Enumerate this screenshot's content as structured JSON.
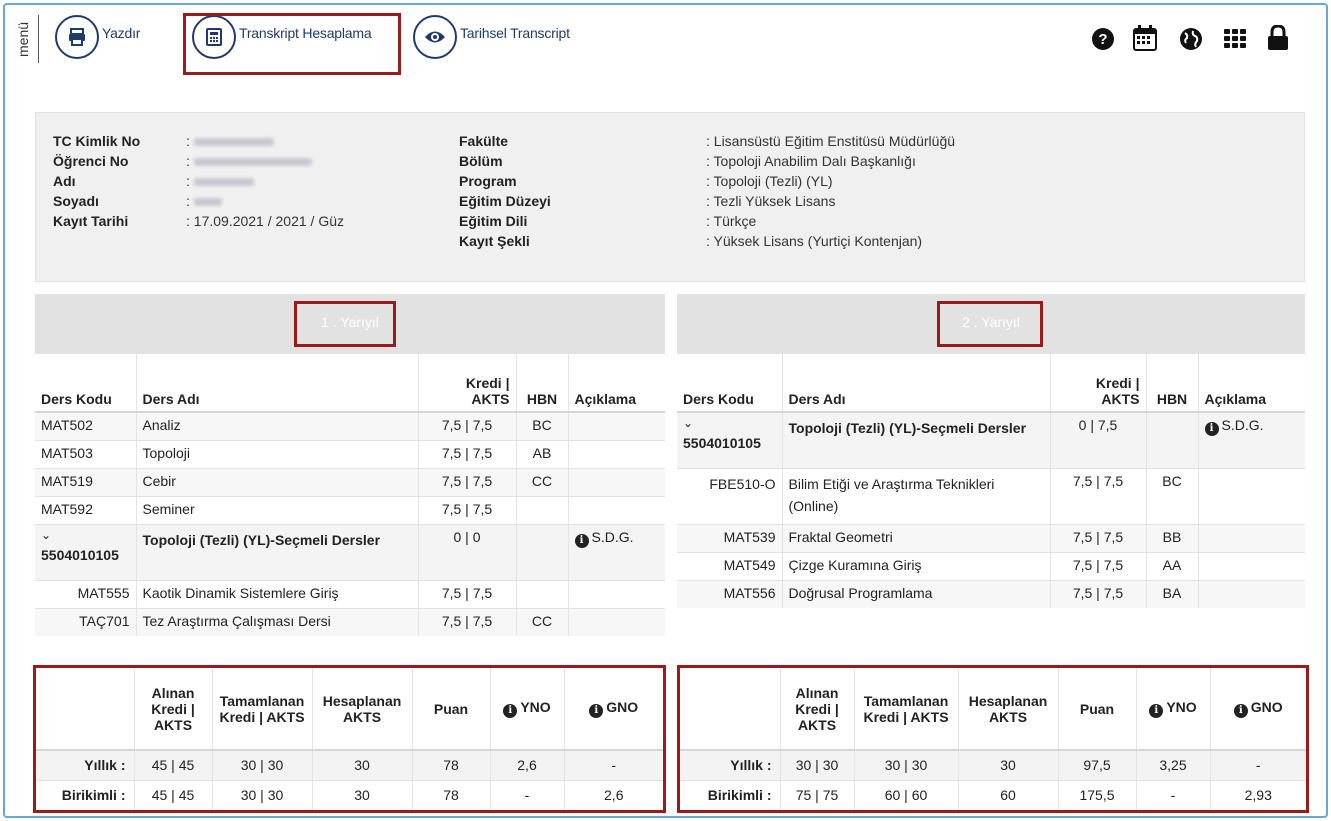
{
  "toolbar": {
    "menu_label": "menü",
    "print_label": "Yazdır",
    "calc_label": "Transkript Hesaplama",
    "history_label": "Tarihsel Transcript"
  },
  "student": {
    "left": [
      {
        "label": "TC Kimlik No",
        "value": ":"
      },
      {
        "label": "Öğrenci No",
        "value": ":"
      },
      {
        "label": "Adı",
        "value": ":"
      },
      {
        "label": "Soyadı",
        "value": ":"
      },
      {
        "label": "Kayıt Tarihi",
        "value": ": 17.09.2021 / 2021 / Güz"
      }
    ],
    "right": [
      {
        "label": "Fakülte",
        "value": ": Lisansüstü Eğitim Enstitüsü Müdürlüğü"
      },
      {
        "label": "Bölüm",
        "value": ": Topoloji Anabilim Dalı Başkanlığı"
      },
      {
        "label": "Program",
        "value": ": Topoloji (Tezli) (YL)"
      },
      {
        "label": "Eğitim Düzeyi",
        "value": ": Tezli Yüksek Lisans"
      },
      {
        "label": "Eğitim Dili",
        "value": ": Türkçe"
      },
      {
        "label": "Kayıt Şekli",
        "value": ": Yüksek Lisans (Yurtiçi Kontenjan)"
      }
    ]
  },
  "headers": {
    "code": "Ders Kodu",
    "name": "Ders Adı",
    "credit": "Kredi | AKTS",
    "hbn": "HBN",
    "note": "Açıklama"
  },
  "sem1": {
    "title": "1 . Yarıyıl",
    "courses": [
      {
        "code": "MAT502",
        "name": "Analiz",
        "credit": "7,5 | 7,5",
        "hbn": "BC",
        "note": ""
      },
      {
        "code": "MAT503",
        "name": "Topoloji",
        "credit": "7,5 | 7,5",
        "hbn": "AB",
        "note": ""
      },
      {
        "code": "MAT519",
        "name": "Cebir",
        "credit": "7,5 | 7,5",
        "hbn": "CC",
        "note": ""
      },
      {
        "code": "MAT592",
        "name": "Seminer",
        "credit": "7,5 | 7,5",
        "hbn": "",
        "note": ""
      }
    ],
    "group": {
      "chevron": "⌄",
      "code": "5504010105",
      "name": "Topoloji (Tezli) (YL)-Seçmeli Dersler",
      "credit": "0 | 0",
      "note": "S.D.G."
    },
    "sub": [
      {
        "code": "MAT555",
        "name": "Kaotik Dinamik Sistemlere Giriş",
        "credit": "7,5 | 7,5",
        "hbn": ""
      },
      {
        "code": "TAÇ701",
        "name": "Tez Araştırma Çalışması Dersi",
        "credit": "7,5 | 7,5",
        "hbn": "CC"
      }
    ],
    "summary": {
      "yearly": {
        "label": "Yıllık :",
        "alinan": "45 | 45",
        "tam": "30 | 30",
        "hes": "30",
        "puan": "78",
        "yno": "2,6",
        "gno": "-"
      },
      "cum": {
        "label": "Birikimli :",
        "alinan": "45 | 45",
        "tam": "30 | 30",
        "hes": "30",
        "puan": "78",
        "yno": "-",
        "gno": "2,6"
      }
    }
  },
  "sem2": {
    "title": "2 . Yarıyıl",
    "group": {
      "chevron": "⌄",
      "code": "5504010105",
      "name": "Topoloji (Tezli) (YL)-Seçmeli Dersler",
      "credit": "0 | 7,5",
      "note": "S.D.G."
    },
    "sub": [
      {
        "code": "FBE510-O",
        "name": "Bilim Etiği ve Araştırma Teknikleri (Online)",
        "credit": "7,5 | 7,5",
        "hbn": "BC"
      },
      {
        "code": "MAT539",
        "name": "Fraktal Geometri",
        "credit": "7,5 | 7,5",
        "hbn": "BB"
      },
      {
        "code": "MAT549",
        "name": "Çizge Kuramına Giriş",
        "credit": "7,5 | 7,5",
        "hbn": "AA"
      },
      {
        "code": "MAT556",
        "name": "Doğrusal Programlama",
        "credit": "7,5 | 7,5",
        "hbn": "BA"
      }
    ],
    "summary": {
      "yearly": {
        "label": "Yıllık :",
        "alinan": "30 | 30",
        "tam": "30 | 30",
        "hes": "30",
        "puan": "97,5",
        "yno": "3,25",
        "gno": "-"
      },
      "cum": {
        "label": "Birikimli :",
        "alinan": "75 | 75",
        "tam": "60 | 60",
        "hes": "60",
        "puan": "175,5",
        "yno": "-",
        "gno": "2,93"
      }
    }
  },
  "summary_headers": {
    "alinan": "Alınan Kredi | AKTS",
    "tam": "Tamamlanan Kredi | AKTS",
    "hes": "Hesaplanan AKTS",
    "puan": "Puan",
    "yno": "YNO",
    "gno": "GNO"
  },
  "icons": {
    "print": "printer-icon",
    "calc": "calculator-icon",
    "history": "eye-icon",
    "help": "question-icon",
    "calendar": "calendar-icon",
    "globe": "globe-icon",
    "apps": "grid-icon",
    "lock": "lock-icon"
  },
  "colors": {
    "accent": "#1f3b6e",
    "highlight": "#9b1b1b",
    "frame": "#6aa6d8"
  }
}
